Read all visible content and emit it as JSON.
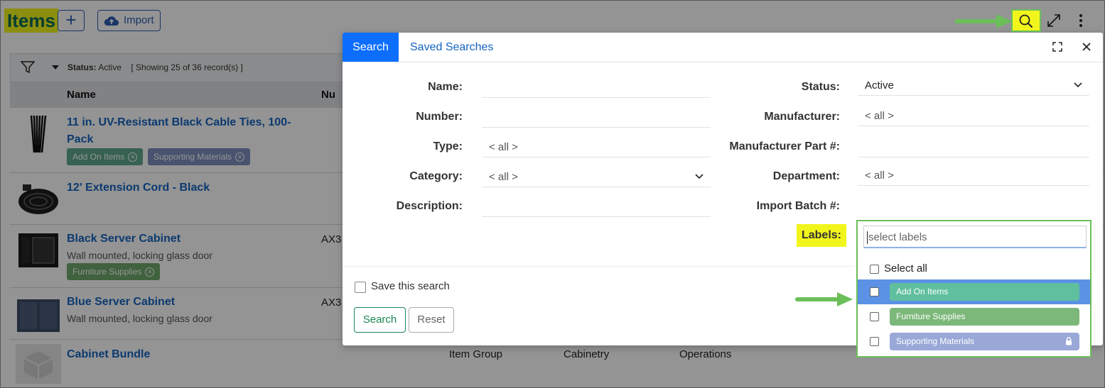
{
  "header": {
    "title": "Items",
    "add_symbol": "+",
    "import_label": "Import"
  },
  "toolbar": {
    "status_label": "Status:",
    "status_value": "Active",
    "showing": "[ Showing 25 of 36 record(s) ]"
  },
  "columns": {
    "name": "Name",
    "number": "Nu"
  },
  "items": [
    {
      "name_line1": "11 in. UV-Resistant Black Cable Ties, 100-",
      "name_line2": "Pack",
      "description": "",
      "number": "",
      "tags": [
        "Add On Items",
        "Supporting Materials"
      ]
    },
    {
      "name_line1": "12' Extension Cord - Black",
      "name_line2": "",
      "description": "",
      "number": "",
      "tags": []
    },
    {
      "name_line1": "Black Server Cabinet",
      "name_line2": "",
      "description": "Wall mounted, locking glass door",
      "number": "AX3",
      "tags": [
        "Furniture Supplies"
      ]
    },
    {
      "name_line1": "Blue Server Cabinet",
      "name_line2": "",
      "description": "Wall mounted, locking glass door",
      "number": "AX3",
      "tags": []
    },
    {
      "name_line1": "Cabinet Bundle",
      "name_line2": "",
      "description": "",
      "number": "",
      "type": "Item Group",
      "category": "Cabinetry",
      "department": "Operations",
      "tags": []
    }
  ],
  "modal": {
    "tab_search": "Search",
    "tab_saved": "Saved Searches",
    "fields_left": [
      {
        "label": "Name:",
        "value": ""
      },
      {
        "label": "Number:",
        "value": ""
      },
      {
        "label": "Type:",
        "value": "< all >"
      },
      {
        "label": "Category:",
        "value": "< all >"
      },
      {
        "label": "Description:",
        "value": ""
      }
    ],
    "fields_right": [
      {
        "label": "Status:",
        "value": "Active"
      },
      {
        "label": "Manufacturer:",
        "value": "< all >"
      },
      {
        "label": "Manufacturer Part #:",
        "value": ""
      },
      {
        "label": "Department:",
        "value": "< all >"
      },
      {
        "label": "Import Batch #:",
        "value": ""
      }
    ],
    "labels_label": "Labels:",
    "save_search_label": "Save this search",
    "search_button": "Search",
    "reset_button": "Reset"
  },
  "labels_dropdown": {
    "placeholder": "select labels",
    "select_all": "Select all",
    "options": [
      {
        "label": "Add On Items",
        "color": "#5fbf9f",
        "locked": false
      },
      {
        "label": "Furniture Supplies",
        "color": "#7cb87a",
        "locked": false
      },
      {
        "label": "Supporting Materials",
        "color": "#9aa8d8",
        "locked": true
      }
    ]
  },
  "colors": {
    "accent": "#0d6efd",
    "link": "#1565c0",
    "highlight": "#f2f51b",
    "callout": "#6bbf59",
    "brand_title": "#0a6b55"
  }
}
